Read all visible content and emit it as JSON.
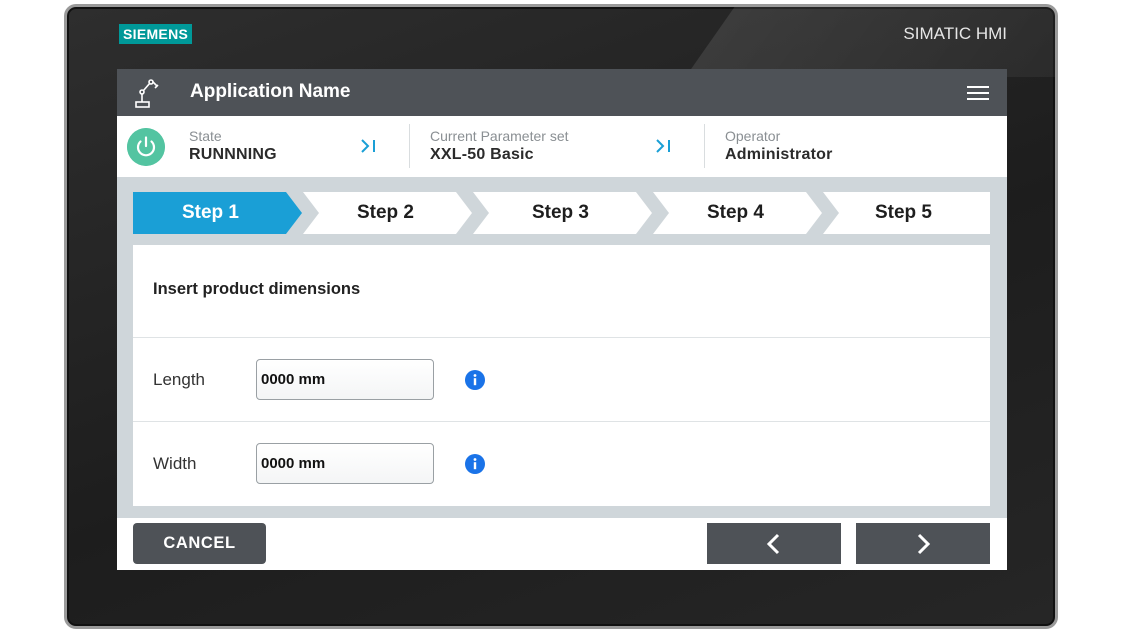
{
  "device": {
    "brand": "SIEMENS",
    "product": "SIMATIC HMI"
  },
  "header": {
    "title": "Application Name",
    "menu_icon": "hamburger-menu-icon",
    "app_icon": "robot-arm-icon"
  },
  "status": {
    "state_label": "State",
    "state_value": "RUNNNING",
    "parameter_label": "Current Parameter set",
    "parameter_value": "XXL-50 Basic",
    "operator_label": "Operator",
    "operator_value": "Administrator",
    "power_icon": "power-icon",
    "jump_icon": "skip-to-end-icon"
  },
  "steps": [
    {
      "label": "Step 1",
      "active": true
    },
    {
      "label": "Step 2",
      "active": false
    },
    {
      "label": "Step 3",
      "active": false
    },
    {
      "label": "Step 4",
      "active": false
    },
    {
      "label": "Step 5",
      "active": false
    }
  ],
  "form": {
    "title": "Insert product dimensions",
    "length_label": "Length",
    "length_value": "0000 mm",
    "width_label": "Width",
    "width_value": "0000 mm",
    "info_icon": "info-icon"
  },
  "footer": {
    "cancel_label": "CANCEL",
    "prev_icon": "chevron-left-icon",
    "next_icon": "chevron-right-icon"
  },
  "colors": {
    "brand": "#009999",
    "header_bg": "#4e5257",
    "active_step": "#1a9fd6",
    "running_status": "#53c4a1",
    "info_blue": "#1a73e8"
  }
}
